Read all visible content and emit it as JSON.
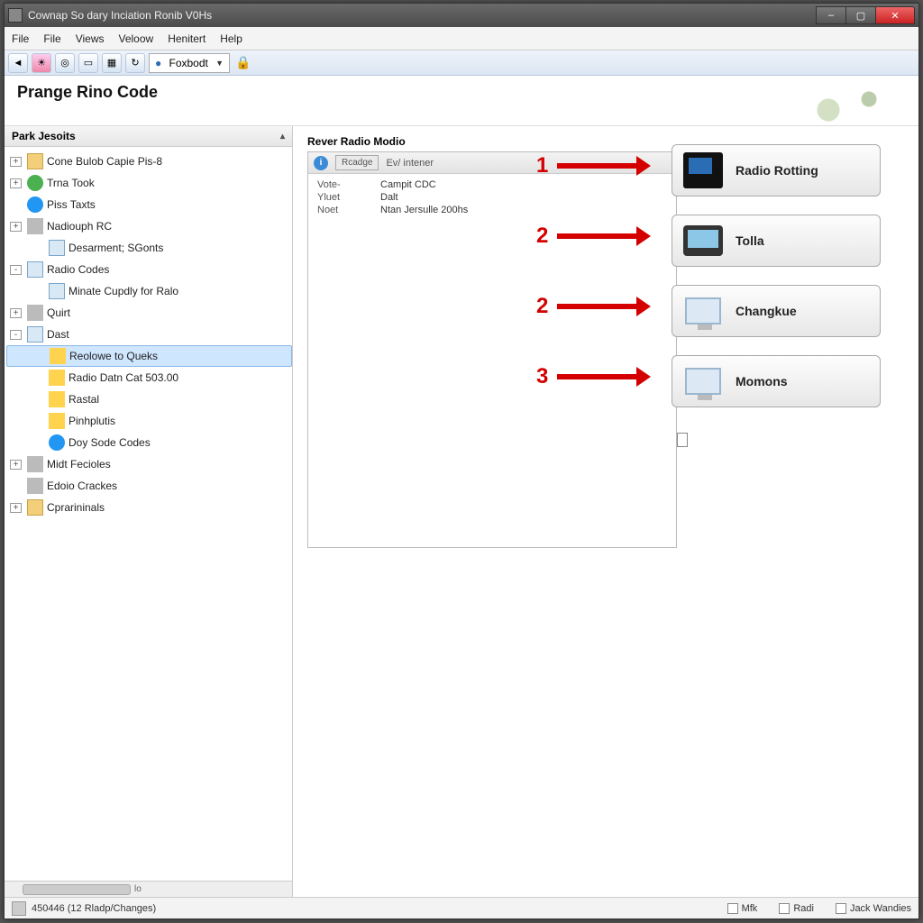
{
  "window": {
    "title": "Cownap So dary Inciation Ronib V0Hs"
  },
  "menubar": [
    "File",
    "File",
    "Views",
    "Veloow",
    "Henitert",
    "Help"
  ],
  "toolbar": {
    "select_label": "Foxbodt",
    "buttons": [
      "back",
      "map",
      "globe",
      "window",
      "grid",
      "refresh"
    ]
  },
  "header": {
    "title": "Prange Rino Code"
  },
  "sidebar": {
    "title": "Park Jesoits",
    "items": [
      {
        "lvl": 1,
        "exp": "+",
        "icon": "folder",
        "label": "Cone Bulob Capie Pis-8"
      },
      {
        "lvl": 1,
        "exp": "+",
        "icon": "green",
        "label": "Trna Took"
      },
      {
        "lvl": 1,
        "exp": "",
        "icon": "blue",
        "label": "Piss Taxts"
      },
      {
        "lvl": 1,
        "exp": "+",
        "icon": "grey",
        "label": "Nadiouph RC"
      },
      {
        "lvl": 2,
        "exp": "",
        "icon": "monitor",
        "label": "Desarment; SGonts"
      },
      {
        "lvl": 1,
        "exp": "-",
        "icon": "monitor",
        "label": "Radio Codes"
      },
      {
        "lvl": 2,
        "exp": "",
        "icon": "monitor",
        "label": "Minate Cupdly for Ralo"
      },
      {
        "lvl": 1,
        "exp": "+",
        "icon": "grey",
        "label": "Quirt"
      },
      {
        "lvl": 1,
        "exp": "-",
        "icon": "monitor",
        "label": "Dast"
      },
      {
        "lvl": 2,
        "exp": "",
        "icon": "yellow",
        "label": "Reolowe to Queks",
        "selected": true
      },
      {
        "lvl": 2,
        "exp": "",
        "icon": "yellow",
        "label": "Radio Datn Cat 503.00"
      },
      {
        "lvl": 2,
        "exp": "",
        "icon": "yellow",
        "label": "Rastal"
      },
      {
        "lvl": 2,
        "exp": "",
        "icon": "yellow",
        "label": "Pinhplutis"
      },
      {
        "lvl": 2,
        "exp": "",
        "icon": "blue",
        "label": "Doy Sode Codes"
      },
      {
        "lvl": 1,
        "exp": "+",
        "icon": "grey",
        "label": "Midt Fecioles"
      },
      {
        "lvl": 1,
        "exp": "",
        "icon": "grey",
        "label": "Edoio Crackes"
      },
      {
        "lvl": 1,
        "exp": "+",
        "icon": "folder",
        "label": "Cprarininals"
      }
    ],
    "scroll_label": "lo"
  },
  "info": {
    "title": "Rever Radio Modio",
    "tab1": "Rcadge",
    "tab2": "Ev/ intener",
    "rows": [
      {
        "k": "Vote-",
        "v": "Campit CDC"
      },
      {
        "k": "Yluet",
        "v": "Dalt"
      },
      {
        "k": "Noet",
        "v": "Ntan Jersulle 200hs"
      }
    ]
  },
  "actions": [
    {
      "icon": "tower",
      "label": "Radio Rotting"
    },
    {
      "icon": "gps",
      "label": "Tolla"
    },
    {
      "icon": "pc",
      "label": "Changkue"
    },
    {
      "icon": "pc",
      "label": "Momons"
    }
  ],
  "annotations": [
    {
      "num": "1"
    },
    {
      "num": "2"
    },
    {
      "num": "2"
    },
    {
      "num": "3"
    }
  ],
  "status": {
    "text": "450446 (12 Rladp/Changes)",
    "checks": [
      "Mfk",
      "Radi",
      "Jack Wandies"
    ]
  }
}
